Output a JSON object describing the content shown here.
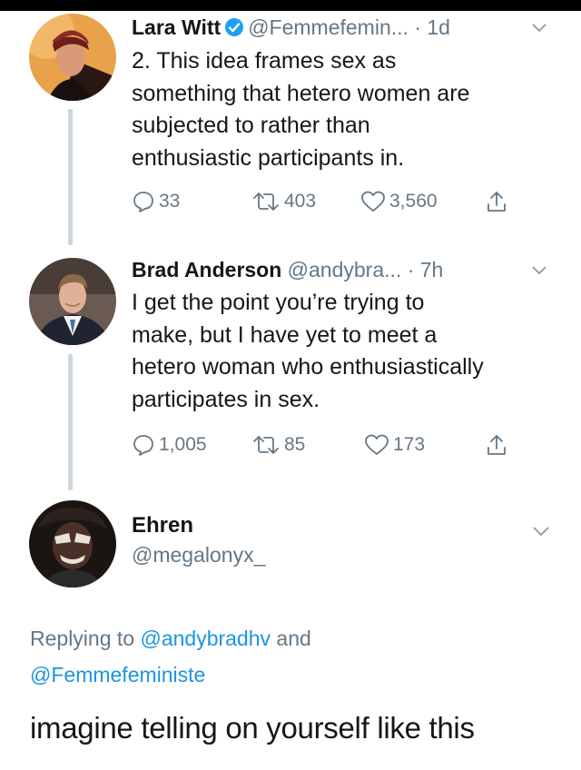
{
  "tweets": [
    {
      "name": "Lara Witt",
      "verified": true,
      "handle": "@Femmefemin...",
      "time": "· 1d",
      "lines": [
        "2. This idea frames sex as",
        "something that hetero women are",
        "subjected to rather than",
        "enthusiastic participants in."
      ],
      "stats": {
        "replies": "33",
        "retweets": "403",
        "likes": "3,560"
      }
    },
    {
      "name": "Brad Anderson",
      "verified": false,
      "handle": "@andybra...",
      "time": "· 7h",
      "lines": [
        "I get the point you’re trying to",
        "make, but I have yet to meet a",
        "hetero woman who enthusiastically",
        "participates in sex."
      ],
      "stats": {
        "replies": "1,005",
        "retweets": "85",
        "likes": "173"
      }
    }
  ],
  "reply": {
    "name": "Ehren",
    "handle": "@megalonyx_",
    "replying_prefix": "Replying to",
    "replying_to_1": "@andybradhv",
    "replying_joiner": "and",
    "replying_to_2": "@Femmefeministe",
    "text": "imagine telling on yourself like this"
  },
  "colors": {
    "text": "#14171a",
    "secondary": "#657786",
    "link": "#1b95e0",
    "verified": "#1da1f2",
    "thread_line": "#ccd6dd"
  }
}
